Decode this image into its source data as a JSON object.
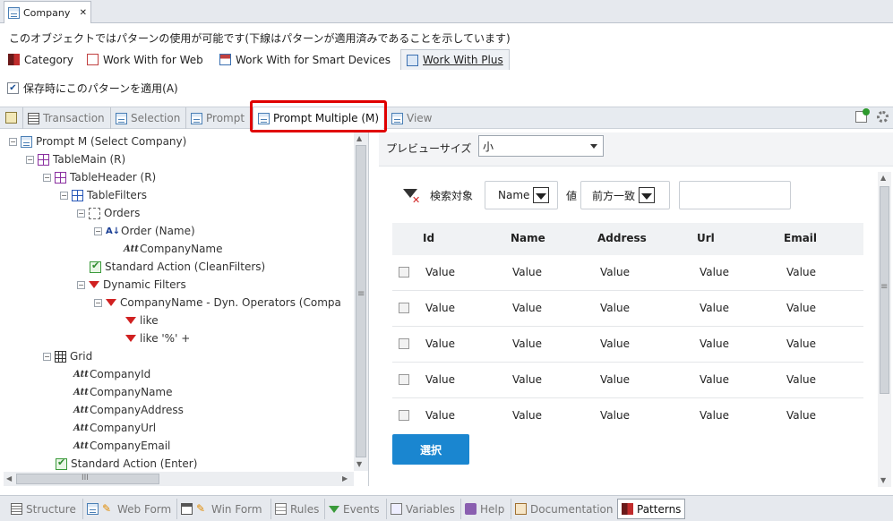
{
  "document_tab": {
    "title": "Company",
    "close": "✕"
  },
  "description": "このオブジェクトではパターンの使用が可能です(下線はパターンが適用済みであることを示しています)",
  "pattern_tabs": [
    {
      "label": "Category"
    },
    {
      "label": "Work With for Web"
    },
    {
      "label": "Work With for Smart Devices"
    },
    {
      "label": "Work With Plus"
    }
  ],
  "apply_checkbox": {
    "label": "保存時にこのパターンを適用(A)",
    "checked": true
  },
  "inner_tabs": [
    {
      "label": "Transaction"
    },
    {
      "label": "Selection"
    },
    {
      "label": "Prompt"
    },
    {
      "label": "Prompt Multiple (M)"
    },
    {
      "label": "View"
    }
  ],
  "tree": [
    {
      "label": "Prompt M (Select Company)",
      "icon": "form-icon"
    },
    {
      "label": "TableMain (R)",
      "icon": "table-icon"
    },
    {
      "label": "TableHeader (R)",
      "icon": "table-icon"
    },
    {
      "label": "TableFilters",
      "icon": "table-icon"
    },
    {
      "label": "Orders",
      "icon": "orders-icon"
    },
    {
      "label": "Order (Name)",
      "icon": "sort-icon"
    },
    {
      "label": "CompanyName",
      "icon": "attribute-icon"
    },
    {
      "label": "Standard Action (CleanFilters)",
      "icon": "action-icon"
    },
    {
      "label": "Dynamic Filters",
      "icon": "filter-icon"
    },
    {
      "label": "CompanyName - Dyn. Operators (Compa",
      "icon": "filter-icon"
    },
    {
      "label": "like",
      "icon": "filter-icon"
    },
    {
      "label": "like '%' +",
      "icon": "filter-icon"
    },
    {
      "label": "Grid",
      "icon": "grid-icon"
    },
    {
      "label": "CompanyId",
      "icon": "attribute-icon"
    },
    {
      "label": "CompanyName",
      "icon": "attribute-icon"
    },
    {
      "label": "CompanyAddress",
      "icon": "attribute-icon"
    },
    {
      "label": "CompanyUrl",
      "icon": "attribute-icon"
    },
    {
      "label": "CompanyEmail",
      "icon": "attribute-icon"
    },
    {
      "label": "Standard Action (Enter)",
      "icon": "action-icon"
    }
  ],
  "scroll_labels": {
    "menu": "≡",
    "bars": "III",
    "up": "▲",
    "down": "▼",
    "left": "◀",
    "right": "▶"
  },
  "preview": {
    "size_label": "プレビューサイズ",
    "size_value": "小",
    "search_label": "検索対象",
    "search_field_value": "Name",
    "value_label": "値",
    "operator_value": "前方一致",
    "filter_input_value": "",
    "columns": [
      "Id",
      "Name",
      "Address",
      "Url",
      "Email"
    ],
    "rows": [
      [
        "Value",
        "Value",
        "Value",
        "Value",
        "Value"
      ],
      [
        "Value",
        "Value",
        "Value",
        "Value",
        "Value"
      ],
      [
        "Value",
        "Value",
        "Value",
        "Value",
        "Value"
      ],
      [
        "Value",
        "Value",
        "Value",
        "Value",
        "Value"
      ],
      [
        "Value",
        "Value",
        "Value",
        "Value",
        "Value"
      ]
    ],
    "select_button": "選択"
  },
  "bottom_tabs": [
    {
      "label": "Structure"
    },
    {
      "label": "Web Form"
    },
    {
      "label": "Win Form"
    },
    {
      "label": "Rules"
    },
    {
      "label": "Events"
    },
    {
      "label": "Variables"
    },
    {
      "label": "Help"
    },
    {
      "label": "Documentation"
    },
    {
      "label": "Patterns"
    }
  ],
  "colors": {
    "highlight": "#e00000",
    "select_button": "#1a86d0",
    "filter_red": "#d02020"
  }
}
